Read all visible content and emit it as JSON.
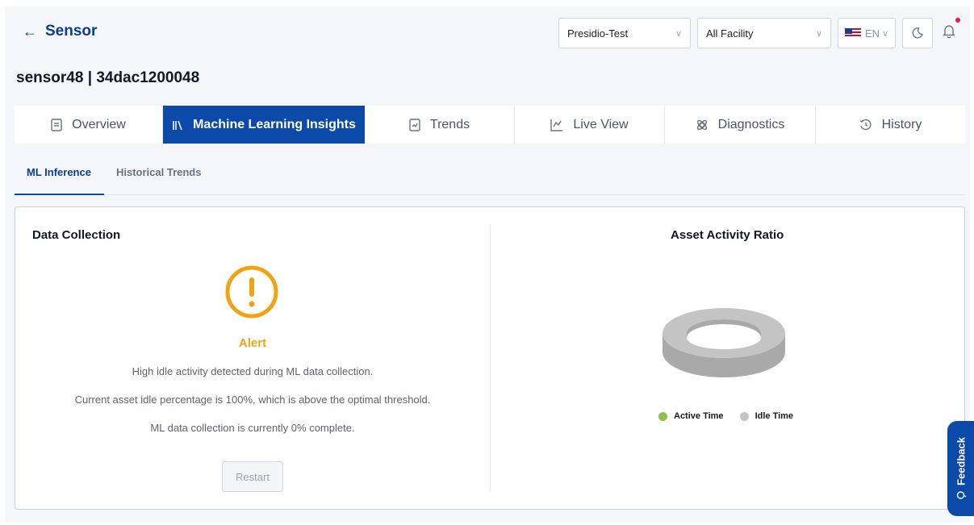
{
  "header": {
    "back_label": "Sensor",
    "sensor_title": "sensor48 | 34dac1200048",
    "organization_select": {
      "value": "Presidio-Test"
    },
    "facility_select": {
      "value": "All Facility"
    },
    "language_select": {
      "value": "EN"
    }
  },
  "main_tabs": [
    {
      "label": "Overview",
      "icon": "document-icon"
    },
    {
      "label": "Machine Learning Insights",
      "icon": "library-icon",
      "active": true
    },
    {
      "label": "Trends",
      "icon": "trend-file-icon"
    },
    {
      "label": "Live View",
      "icon": "chart-icon"
    },
    {
      "label": "Diagnostics",
      "icon": "diagnostics-icon"
    },
    {
      "label": "History",
      "icon": "history-icon"
    }
  ],
  "sub_tabs": [
    {
      "label": "ML Inference",
      "active": true
    },
    {
      "label": "Historical Trends"
    }
  ],
  "data_collection": {
    "title": "Data Collection",
    "status": "Alert",
    "messages": [
      "High idle activity detected during ML data collection.",
      "Current asset idle percentage is 100%, which is above the optimal threshold.",
      "ML data collection is currently 0% complete."
    ],
    "restart_label": "Restart"
  },
  "activity_ratio": {
    "title": "Asset Activity Ratio",
    "legend": [
      {
        "label": "Active Time",
        "color": "#8bc34a"
      },
      {
        "label": "Idle Time",
        "color": "#c4c4c4"
      }
    ]
  },
  "chart_data": {
    "type": "pie",
    "categories": [
      "Active Time",
      "Idle Time"
    ],
    "values": [
      0,
      100
    ],
    "title": "Asset Activity Ratio",
    "legend_position": "bottom"
  },
  "feedback": {
    "label": "Feedback"
  },
  "colors": {
    "primary": "#0b4aa8",
    "alert": "#f2a313",
    "active": "#8bc34a",
    "idle": "#c4c4c4"
  }
}
